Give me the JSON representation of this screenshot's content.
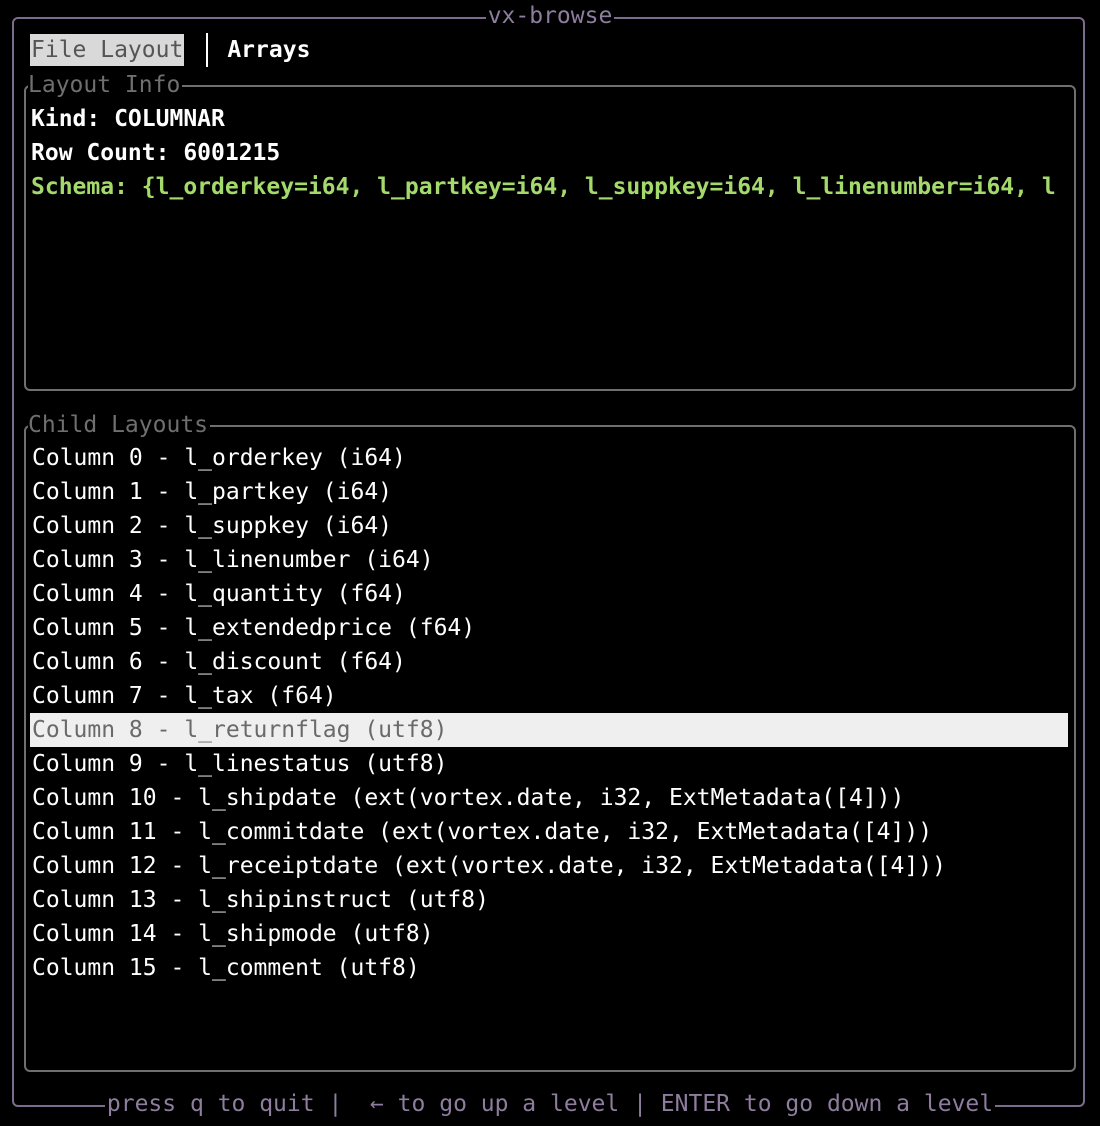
{
  "window": {
    "title": "vx-browse"
  },
  "tabs": [
    {
      "label": "File Layout",
      "active": true
    },
    {
      "label": "Arrays",
      "active": false
    }
  ],
  "layout_info": {
    "title": "Layout Info",
    "kind": "Kind: COLUMNAR",
    "row_count": "Row Count: 6001215",
    "schema": "Schema: {l_orderkey=i64, l_partkey=i64, l_suppkey=i64, l_linenumber=i64, l"
  },
  "child_layouts": {
    "title": "Child Layouts",
    "selected_index": 8,
    "items": [
      "Column 0 - l_orderkey (i64)",
      "Column 1 - l_partkey (i64)",
      "Column 2 - l_suppkey (i64)",
      "Column 3 - l_linenumber (i64)",
      "Column 4 - l_quantity (f64)",
      "Column 5 - l_extendedprice (f64)",
      "Column 6 - l_discount (f64)",
      "Column 7 - l_tax (f64)",
      "Column 8 - l_returnflag (utf8)",
      "Column 9 - l_linestatus (utf8)",
      "Column 10 - l_shipdate (ext(vortex.date, i32, ExtMetadata([4]))",
      "Column 11 - l_commitdate (ext(vortex.date, i32, ExtMetadata([4]))",
      "Column 12 - l_receiptdate (ext(vortex.date, i32, ExtMetadata([4]))",
      "Column 13 - l_shipinstruct (utf8)",
      "Column 14 - l_shipmode (utf8)",
      "Column 15 - l_comment (utf8)"
    ]
  },
  "footer": {
    "help": "press q to quit |  ← to go up a level | ENTER to go down a level"
  },
  "colors": {
    "frame": "#7c6b8c",
    "panel_border": "#6f6f6f",
    "schema_text": "#a4d96c",
    "selection_bg": "#efefef",
    "background": "#000000"
  }
}
